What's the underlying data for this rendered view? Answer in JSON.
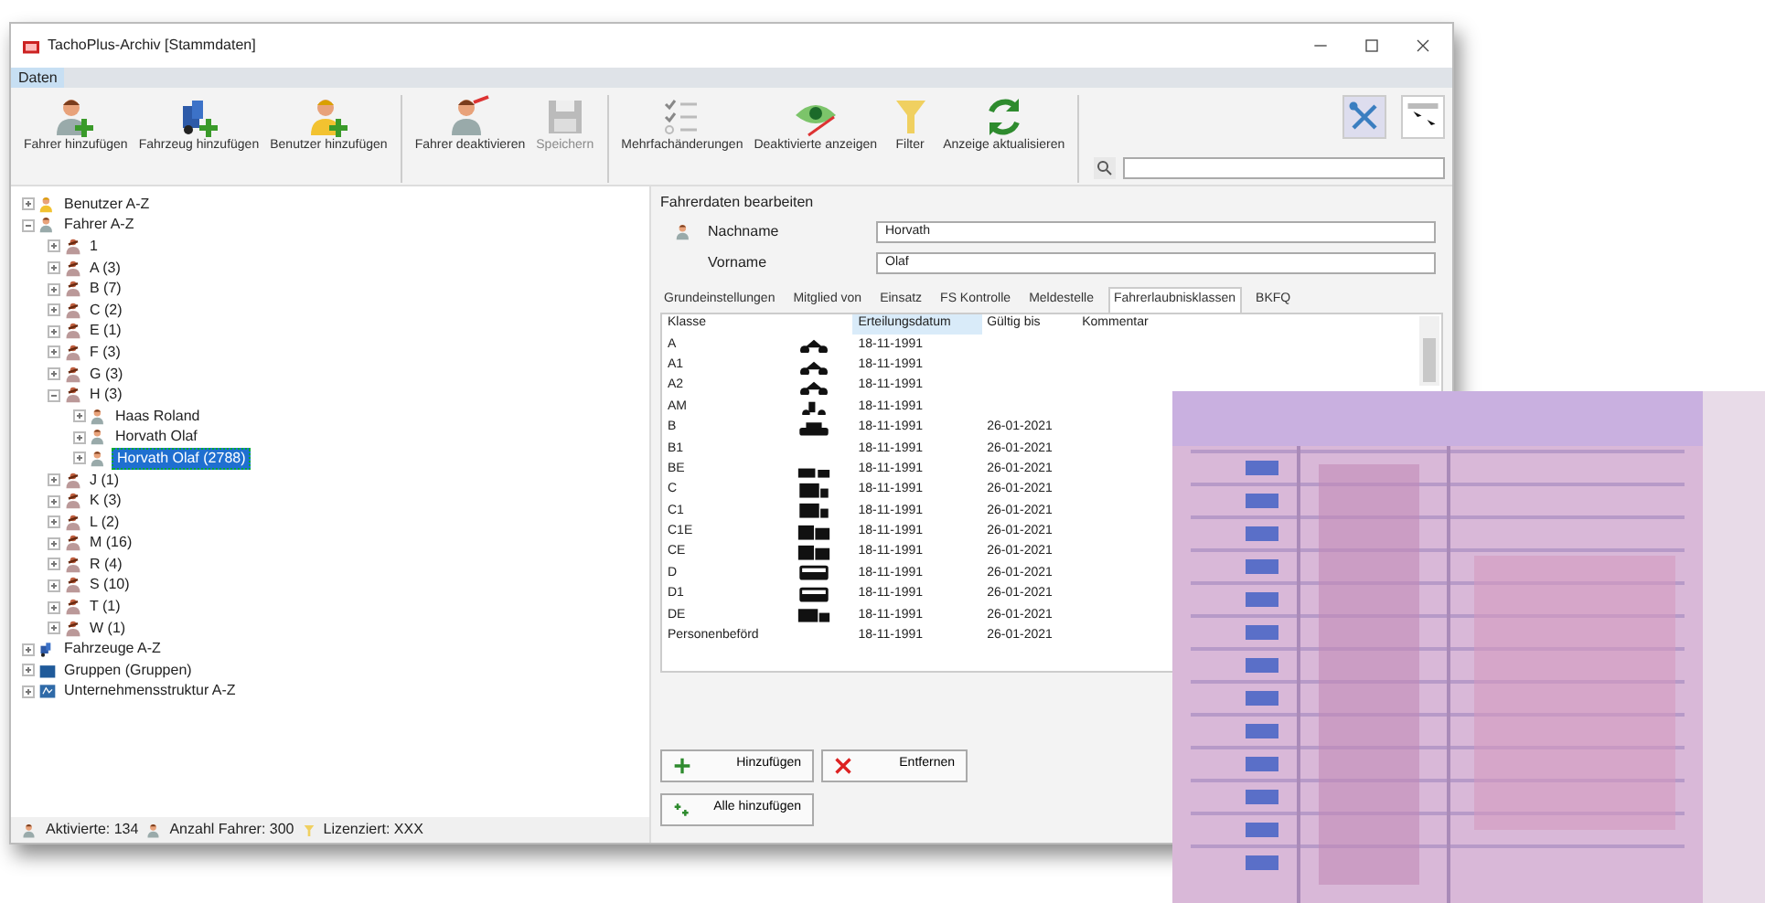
{
  "window": {
    "title": "TachoPlus-Archiv [Stammdaten]"
  },
  "menu": [
    {
      "label": "Daten",
      "selected": true
    }
  ],
  "toolbar": [
    [
      {
        "kind": "driver-add",
        "label": "Fahrer hinzufügen",
        "disabled": false
      },
      {
        "kind": "truck-add",
        "label": "Fahrzeug hinzufügen",
        "disabled": false
      },
      {
        "kind": "user-add",
        "label": "Benutzer hinzufügen",
        "disabled": false
      }
    ],
    [
      {
        "kind": "driver-remove",
        "label": "Fahrer deaktivieren",
        "disabled": false
      },
      {
        "kind": "save",
        "label": "Speichern",
        "disabled": true
      }
    ],
    [
      {
        "kind": "checklist",
        "label": "Mehrfachänderungen",
        "disabled": false
      },
      {
        "kind": "eye",
        "label": "Deaktivierte anzeigen",
        "disabled": false
      },
      {
        "kind": "filter",
        "label": "Filter",
        "disabled": false
      },
      {
        "kind": "refresh",
        "label": "Anzeige aktualisieren",
        "disabled": false
      }
    ]
  ],
  "tree": [
    {
      "kind": "user",
      "label": "Benutzer A-Z",
      "expanded": false,
      "selected": false
    },
    {
      "kind": "driver",
      "label": "Fahrer A-Z",
      "expanded": true,
      "selected": false,
      "children": [
        {
          "kind": "group",
          "label": "1",
          "expanded": false,
          "selected": false
        },
        {
          "kind": "group",
          "label": "A (3)",
          "expanded": false,
          "selected": false
        },
        {
          "kind": "group",
          "label": "B (7)",
          "expanded": false,
          "selected": false
        },
        {
          "kind": "group",
          "label": "C (2)",
          "expanded": false,
          "selected": false
        },
        {
          "kind": "group",
          "label": "E (1)",
          "expanded": false,
          "selected": false
        },
        {
          "kind": "group",
          "label": "F (3)",
          "expanded": false,
          "selected": false
        },
        {
          "kind": "group",
          "label": "G (3)",
          "expanded": false,
          "selected": false
        },
        {
          "kind": "group",
          "label": "H (3)",
          "expanded": true,
          "selected": false,
          "children": [
            {
              "kind": "driver",
              "label": "Haas Roland",
              "expanded": false,
              "selected": false
            },
            {
              "kind": "driver",
              "label": "Horvath Olaf",
              "expanded": false,
              "selected": false
            },
            {
              "kind": "driver",
              "label": "Horvath Olaf (2788)",
              "expanded": false,
              "selected": true
            }
          ]
        },
        {
          "kind": "group",
          "label": "J (1)",
          "expanded": false,
          "selected": false
        },
        {
          "kind": "group",
          "label": "K (3)",
          "expanded": false,
          "selected": false
        },
        {
          "kind": "group",
          "label": "L (2)",
          "expanded": false,
          "selected": false
        },
        {
          "kind": "group",
          "label": "M (16)",
          "expanded": false,
          "selected": false
        },
        {
          "kind": "group",
          "label": "R (4)",
          "expanded": false,
          "selected": false
        },
        {
          "kind": "group",
          "label": "S (10)",
          "expanded": false,
          "selected": false
        },
        {
          "kind": "group",
          "label": "T (1)",
          "expanded": false,
          "selected": false
        },
        {
          "kind": "group",
          "label": "W (1)",
          "expanded": false,
          "selected": false
        }
      ]
    },
    {
      "kind": "vehicle",
      "label": "Fahrzeuge A-Z",
      "expanded": false,
      "selected": false
    },
    {
      "kind": "folder",
      "label": "Gruppen (Gruppen)",
      "expanded": false,
      "selected": false
    },
    {
      "kind": "company",
      "label": "Unternehmensstruktur A-Z",
      "expanded": false,
      "selected": false
    }
  ],
  "status_bar": [
    {
      "kind": "driver",
      "text": "Aktivierte: 134"
    },
    {
      "kind": "driver",
      "text": "Anzahl Fahrer: 300"
    },
    {
      "kind": "filter",
      "text": "Lizenziert: XXX"
    }
  ],
  "editor": {
    "title": "Fahrerdaten bearbeiten",
    "fields": [
      {
        "label": "Nachname",
        "value": "Horvath"
      },
      {
        "label": "Vorname",
        "value": "Olaf"
      }
    ],
    "tabs": [
      {
        "label": "Grundeinstellungen",
        "selected": false
      },
      {
        "label": "Mitglied von",
        "selected": false
      },
      {
        "label": "Einsatz",
        "selected": false
      },
      {
        "label": "FS Kontrolle",
        "selected": false
      },
      {
        "label": "Meldestelle",
        "selected": false
      },
      {
        "label": "Fahrerlaubnisklassen",
        "selected": true
      },
      {
        "label": "BKFQ",
        "selected": false
      }
    ],
    "table": {
      "columns": [
        {
          "label": "Klasse",
          "sorted": false
        },
        {
          "label": "Erteilungsdatum",
          "sorted": true
        },
        {
          "label": "Gültig bis",
          "sorted": false
        },
        {
          "label": "Kommentar",
          "sorted": false
        }
      ],
      "rows": [
        {
          "class": "A",
          "kind": "motorcycle",
          "issued": "18-11-1991"
        },
        {
          "class": "A1",
          "kind": "motorcycle",
          "issued": "18-11-1991"
        },
        {
          "class": "A2",
          "kind": "motorcycle",
          "issued": "18-11-1991"
        },
        {
          "class": "AM",
          "kind": "moped",
          "issued": "18-11-1991"
        },
        {
          "class": "B",
          "kind": "car",
          "issued": "18-11-1991",
          "valid_until": "26-01-2021"
        },
        {
          "class": "B1",
          "issued": "18-11-1991",
          "valid_until": "26-01-2021"
        },
        {
          "class": "BE",
          "kind": "car-trailer",
          "issued": "18-11-1991",
          "valid_until": "26-01-2021"
        },
        {
          "class": "C",
          "kind": "truck",
          "issued": "18-11-1991",
          "valid_until": "26-01-2021"
        },
        {
          "class": "C1",
          "kind": "truck",
          "issued": "18-11-1991",
          "valid_until": "26-01-2021"
        },
        {
          "class": "C1E",
          "kind": "truck-trailer",
          "issued": "18-11-1991",
          "valid_until": "26-01-2021"
        },
        {
          "class": "CE",
          "kind": "truck-trailer",
          "issued": "18-11-1991",
          "valid_until": "26-01-2021"
        },
        {
          "class": "D",
          "kind": "bus",
          "issued": "18-11-1991",
          "valid_until": "26-01-2021"
        },
        {
          "class": "D1",
          "kind": "bus",
          "issued": "18-11-1991",
          "valid_until": "26-01-2021"
        },
        {
          "class": "DE",
          "kind": "bus-trailer",
          "issued": "18-11-1991",
          "valid_until": "26-01-2021"
        },
        {
          "class": "Personenbeförd",
          "issued": "18-11-1991",
          "valid_until": "26-01-2021"
        }
      ]
    },
    "buttons": [
      {
        "kind": "add",
        "label": "Hinzufügen"
      },
      {
        "kind": "remove",
        "label": "Entfernen"
      },
      {
        "kind": "add-all",
        "label": "Alle hinzufügen"
      }
    ]
  },
  "overlay": {
    "kind": "picture"
  }
}
